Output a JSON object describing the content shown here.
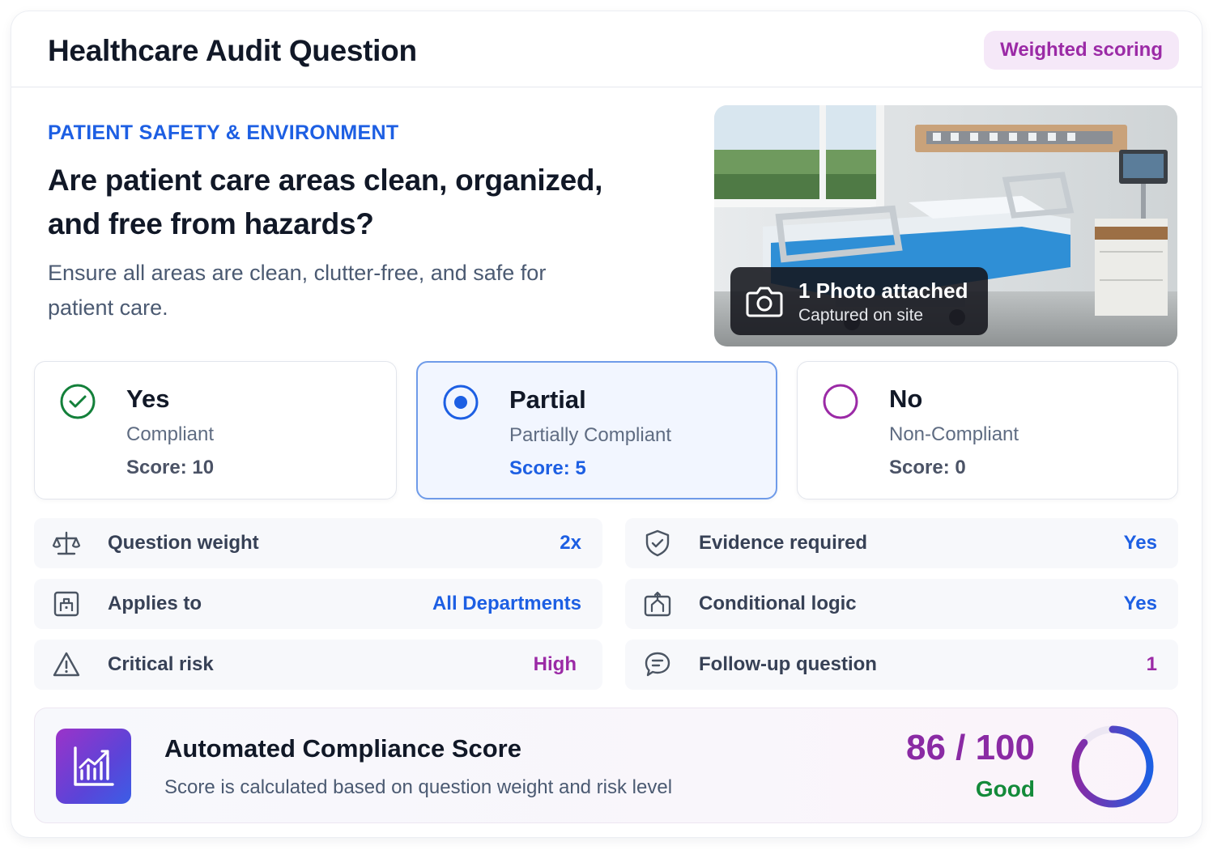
{
  "header": {
    "title": "Healthcare Audit Question",
    "badge": "Weighted scoring"
  },
  "question": {
    "category": "PATIENT SAFETY & ENVIRONMENT",
    "text": "Are patient care areas clean, organized, and free from hazards?",
    "description": "Ensure all areas are clean, clutter-free, and safe for patient care."
  },
  "photo": {
    "count_label": "1 Photo attached",
    "caption": "Captured on site",
    "icon": "camera-icon"
  },
  "options": [
    {
      "label": "Yes",
      "sublabel": "Compliant",
      "score": "Score: 10",
      "state": "compliant",
      "color": "#13803a"
    },
    {
      "label": "Partial",
      "sublabel": "Partially Compliant",
      "score": "Score: 5",
      "state": "selected",
      "color": "#1d5fe3"
    },
    {
      "label": "No",
      "sublabel": "Non-Compliant",
      "score": "Score: 0",
      "state": "unselected",
      "color": "#9b2aa6"
    }
  ],
  "meta": {
    "question_weight": {
      "label": "Question weight",
      "value": "2x",
      "icon": "scale-icon"
    },
    "applies_to": {
      "label": "Applies to",
      "value": "All Departments",
      "icon": "building-icon"
    },
    "critical_risk": {
      "label": "Critical risk",
      "value": "High",
      "icon": "warning-icon"
    },
    "evidence_required": {
      "label": "Evidence required",
      "value": "Yes",
      "icon": "shield-check-icon"
    },
    "conditional_logic": {
      "label": "Conditional logic",
      "value": "Yes",
      "icon": "branch-icon"
    },
    "follow_up": {
      "label": "Follow-up question",
      "value": "1",
      "icon": "chat-icon"
    }
  },
  "compliance": {
    "title": "Automated Compliance Score",
    "subtitle": "Score is calculated based on question weight and risk level",
    "score_text": "86 / 100",
    "status": "Good",
    "score": 86,
    "max": 100,
    "icon": "chart-icon"
  },
  "colors": {
    "accent_blue": "#1d5fe3",
    "accent_purple": "#9b2aa6",
    "good_green": "#138a3a"
  }
}
